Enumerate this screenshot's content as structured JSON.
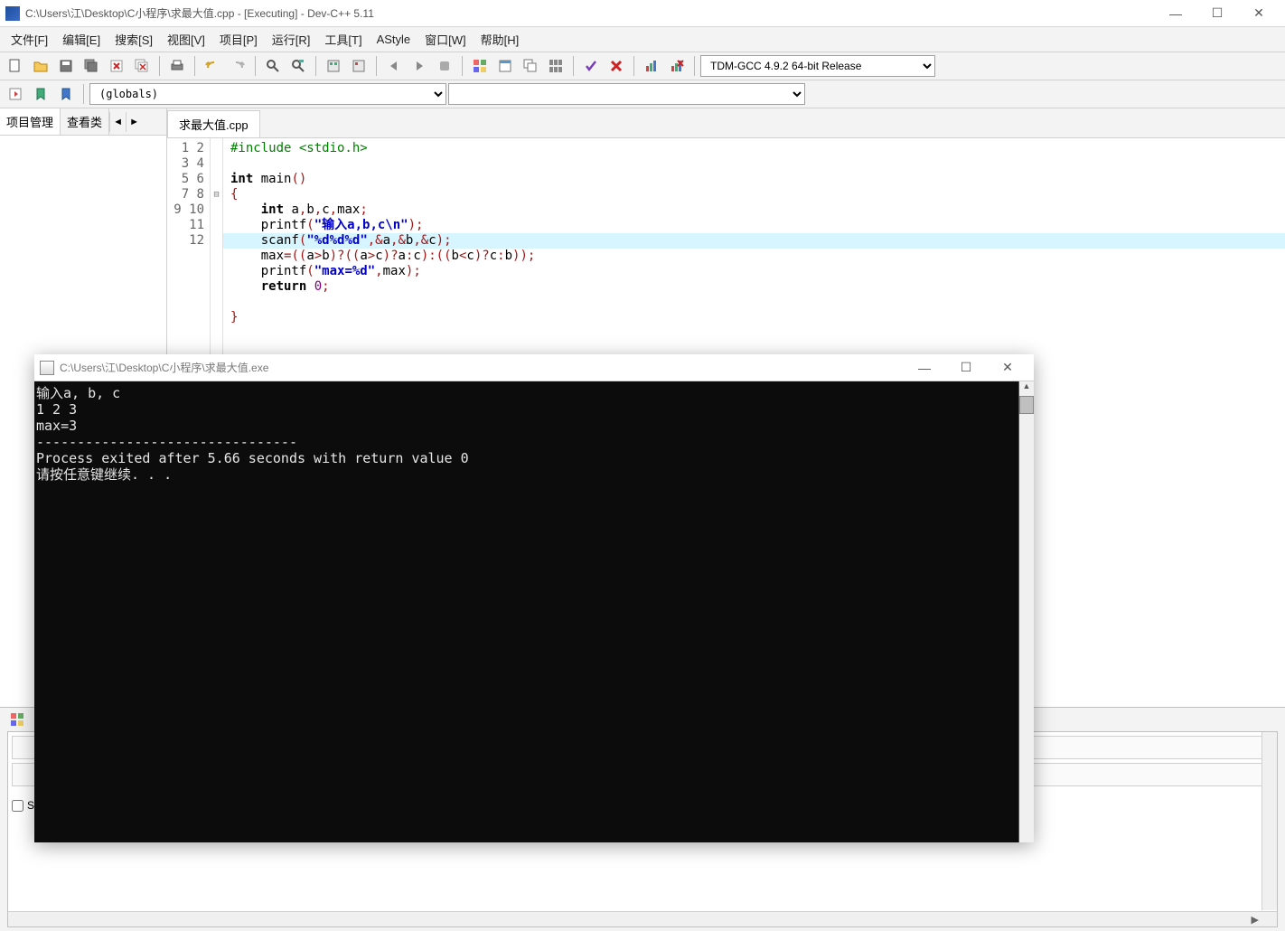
{
  "titlebar": {
    "title": "C:\\Users\\江\\Desktop\\C小程序\\求最大值.cpp - [Executing] - Dev-C++ 5.11"
  },
  "menu": [
    "文件[F]",
    "编辑[E]",
    "搜索[S]",
    "视图[V]",
    "项目[P]",
    "运行[R]",
    "工具[T]",
    "AStyle",
    "窗口[W]",
    "帮助[H]"
  ],
  "compiler_select": "TDM-GCC 4.9.2 64-bit Release",
  "globals_select": "(globals)",
  "side_tabs": {
    "project": "项目管理",
    "classes": "查看类"
  },
  "file_tab": "求最大值.cpp",
  "code": {
    "line_count": 12,
    "highlighted_line": 7
  },
  "code_lines": {
    "l1_include": "#include ",
    "l1_header": "<stdio.h>",
    "l3_int": "int",
    "l3_main": " main",
    "l5_int": "int",
    "l5_vars": " a",
    "l5_vars2": "b",
    "l5_vars3": "c",
    "l5_vars4": "max",
    "l6_fn": "printf",
    "l6_str": "\"输入a,b,c\\n\"",
    "l7_fn": "scanf",
    "l7_str": "\"%d%d%d\"",
    "l7_a": "a",
    "l7_b": "b",
    "l7_c": "c",
    "l8_max": "max",
    "l8_a": "a",
    "l8_b": "b",
    "l8_c": "c",
    "l9_fn": "printf",
    "l9_str": "\"max=%d\"",
    "l9_max": "max",
    "l10_ret": "return",
    "l10_zero": "0"
  },
  "compiler_panel": {
    "shorten_label": "S"
  },
  "console": {
    "title": "C:\\Users\\江\\Desktop\\C小程序\\求最大值.exe",
    "lines": [
      "输入a, b, c",
      "1 2 3",
      "max=3",
      "--------------------------------",
      "Process exited after 5.66 seconds with return value 0",
      "请按任意键继续. . ."
    ]
  }
}
